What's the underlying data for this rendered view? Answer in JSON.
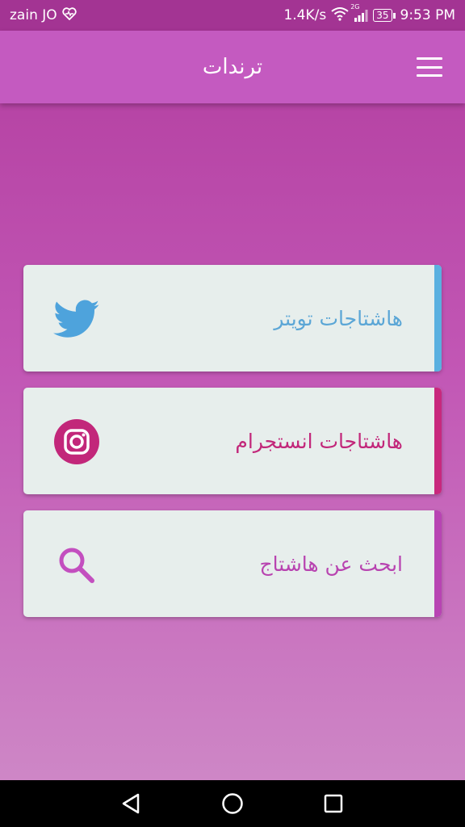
{
  "status_bar": {
    "carrier": "zain JO",
    "speed": "1.4K/s",
    "network": "2G",
    "battery": "35",
    "time": "9:53 PM"
  },
  "app_bar": {
    "title": "ترندات",
    "menu_icon": "hamburger-menu-icon"
  },
  "cards": [
    {
      "label": "هاشتاجات تويتر",
      "icon": "twitter-bird-icon",
      "text_color": "#5ba6d6",
      "accent_color": "#5ab0e0"
    },
    {
      "label": "هاشتاجات انستجرام",
      "icon": "instagram-icon",
      "text_color": "#c2277a",
      "accent_color": "#c8287d"
    },
    {
      "label": "ابحث عن هاشتاج",
      "icon": "search-icon",
      "text_color": "#b843b0",
      "accent_color": "#b844b3"
    }
  ],
  "nav_bar": {
    "back_icon": "back-triangle-icon",
    "home_icon": "home-circle-icon",
    "recents_icon": "recents-square-icon"
  }
}
